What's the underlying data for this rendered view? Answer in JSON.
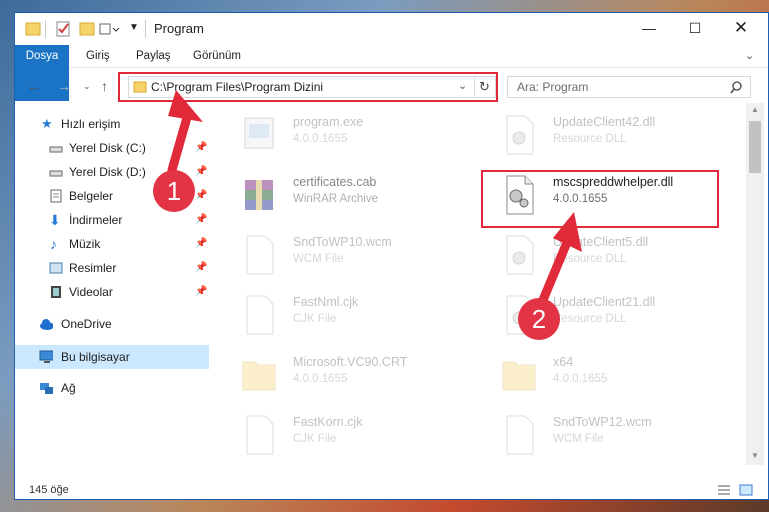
{
  "window": {
    "title": "Program"
  },
  "ribbon": {
    "tabs": [
      "Dosya",
      "Giriş",
      "Paylaş",
      "Görünüm"
    ]
  },
  "address": {
    "path": "C:\\Program Files\\Program Dizini"
  },
  "search": {
    "placeholder": "Ara: Program"
  },
  "sidebar": {
    "items": [
      {
        "label": "Hızlı erişim",
        "icon": "star-icon"
      },
      {
        "label": "Yerel Disk (C:)",
        "icon": "drive-icon",
        "pinned": true
      },
      {
        "label": "Yerel Disk (D:)",
        "icon": "drive-icon",
        "pinned": true
      },
      {
        "label": "Belgeler",
        "icon": "documents-icon",
        "pinned": true
      },
      {
        "label": "İndirmeler",
        "icon": "download-icon",
        "pinned": true
      },
      {
        "label": "Müzik",
        "icon": "music-icon",
        "pinned": true
      },
      {
        "label": "Resimler",
        "icon": "pictures-icon",
        "pinned": true
      },
      {
        "label": "Videolar",
        "icon": "video-icon",
        "pinned": true
      },
      {
        "label": "OneDrive",
        "icon": "cloud-icon"
      },
      {
        "label": "Bu bilgisayar",
        "icon": "computer-icon",
        "selected": true
      },
      {
        "label": "Ağ",
        "icon": "network-icon"
      }
    ]
  },
  "files": [
    {
      "name": "program.exe",
      "sub": "4.0.0.1655",
      "icon": "exe-icon"
    },
    {
      "name": "UpdateClient42.dll",
      "sub": "Resource DLL",
      "icon": "dll-icon"
    },
    {
      "name": "certificates.cab",
      "sub": "WinRAR Archive",
      "icon": "archive-icon"
    },
    {
      "name": "mscspreddwhelper.dll",
      "sub": "4.0.0.1655",
      "icon": "dll-icon",
      "highlighted": true
    },
    {
      "name": "SndToWP10.wcm",
      "sub": "WCM File",
      "icon": "blank-file-icon"
    },
    {
      "name": "UpdateClient5.dll",
      "sub": "Resource DLL",
      "icon": "dll-icon"
    },
    {
      "name": "FastNml.cjk",
      "sub": "CJK File",
      "icon": "blank-file-icon"
    },
    {
      "name": "UpdateClient21.dll",
      "sub": "Resource DLL",
      "icon": "dll-icon"
    },
    {
      "name": "Microsoft.VC90.CRT",
      "sub": "4.0.0.1655",
      "icon": "folder-icon"
    },
    {
      "name": "x64",
      "sub": "4.0.0.1655",
      "icon": "folder-icon"
    },
    {
      "name": "FastKorn.cjk",
      "sub": "CJK File",
      "icon": "blank-file-icon"
    },
    {
      "name": "SndToWP12.wcm",
      "sub": "WCM File",
      "icon": "blank-file-icon"
    }
  ],
  "status": {
    "count": "145 öğe"
  },
  "annotations": {
    "step1": "1",
    "step2": "2"
  },
  "colors": {
    "accent": "#1a73c4",
    "highlight": "#e02a3a",
    "selected": "#cce8ff"
  }
}
